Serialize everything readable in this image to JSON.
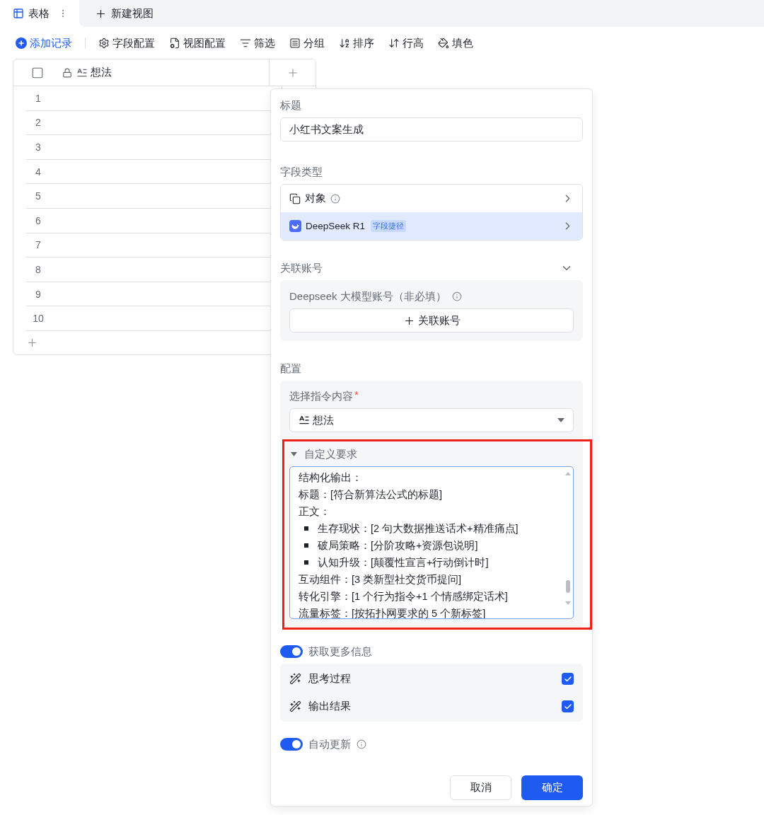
{
  "view_tabs": [
    {
      "label": "表格",
      "kind": "table",
      "selected": true
    },
    {
      "label": "新建视图",
      "kind": "add",
      "selected": false
    }
  ],
  "toolbar": [
    {
      "label": "添加记录",
      "kind": "add"
    },
    {
      "label": "字段配置",
      "kind": "gear"
    },
    {
      "label": "视图配置",
      "kind": "view"
    },
    {
      "label": "筛选",
      "kind": "filter"
    },
    {
      "label": "分组",
      "kind": "group"
    },
    {
      "label": "排序",
      "kind": "sort"
    },
    {
      "label": "行高",
      "kind": "height"
    },
    {
      "label": "填色",
      "kind": "fill"
    }
  ],
  "table": {
    "select_all": {
      "checked": false
    },
    "columns": [
      {
        "label": "想法",
        "locked": true
      }
    ],
    "rows": [
      "1",
      "2",
      "3",
      "4",
      "5",
      "6",
      "7",
      "8",
      "9",
      "10"
    ]
  },
  "panel": {
    "title": {
      "label": "标题",
      "value": "小红书文案生成"
    },
    "field_type": {
      "label": "字段类型",
      "options": [
        {
          "label": "对象",
          "kind": "object",
          "selected": false
        },
        {
          "label": "DeepSeek R1",
          "badge": "字段捷径",
          "kind": "deepseek",
          "selected": true
        }
      ]
    },
    "account": {
      "label": "关联账号",
      "expanded": true,
      "field_label": "Deepseek 大模型账号（非必填）",
      "button": "关联账号"
    },
    "config": {
      "label": "配置",
      "instruction": {
        "label": "选择指令内容",
        "required_mark": "*",
        "value": "想法"
      },
      "custom": {
        "label": "自定义要求",
        "expanded": true,
        "highlighted": true,
        "lines": [
          {
            "kind": "text",
            "text": "结构化输出："
          },
          {
            "kind": "text",
            "text": "标题：[符合新算法公式的标题]"
          },
          {
            "kind": "text",
            "text": "正文："
          },
          {
            "kind": "bullet",
            "text": "生存现状：[2 句大数据推送话术+精准痛点]"
          },
          {
            "kind": "bullet",
            "text": "破局策略：[分阶攻略+资源包说明]"
          },
          {
            "kind": "bullet",
            "text": "认知升级：[颠覆性宣言+行动倒计时]"
          },
          {
            "kind": "text",
            "text": "互动组件：[3 类新型社交货币提问]"
          },
          {
            "kind": "text",
            "text": "转化引擎：[1 个行为指令+1 个情感绑定话术]"
          },
          {
            "kind": "text",
            "text": "流量标签：[按拓扑网要求的 5 个新标签]"
          }
        ]
      }
    },
    "more_info": {
      "label": "获取更多信息",
      "on": true,
      "outputs": [
        {
          "label": "思考过程",
          "checked": true
        },
        {
          "label": "输出结果",
          "checked": true
        }
      ]
    },
    "auto_update": {
      "label": "自动更新",
      "on": true
    },
    "buttons": [
      {
        "label": "取消",
        "kind": "secondary"
      },
      {
        "label": "确定",
        "kind": "primary"
      }
    ]
  }
}
